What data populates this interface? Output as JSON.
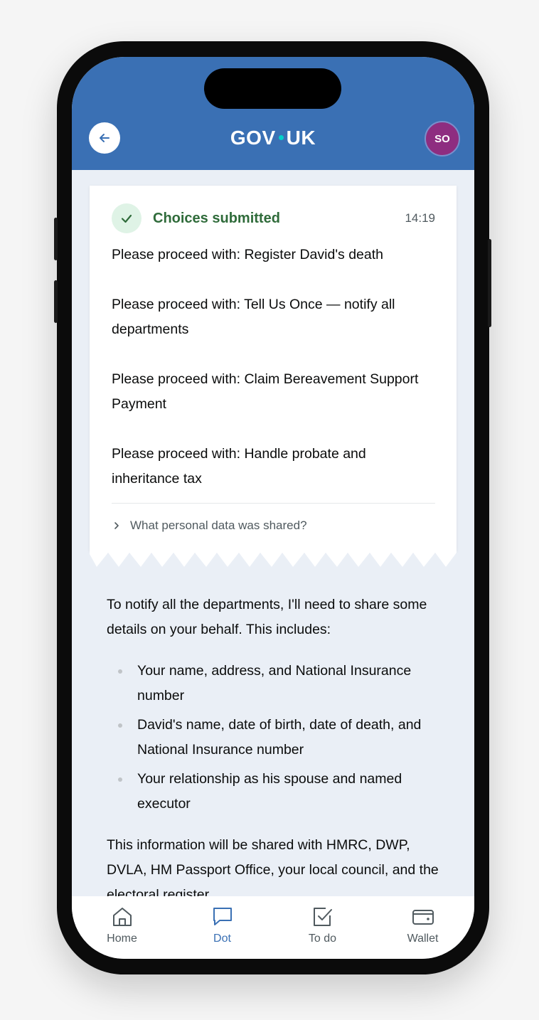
{
  "header": {
    "logo_left": "GOV",
    "logo_right": "UK",
    "avatar_initials": "SO",
    "brand_color": "#3a70b4"
  },
  "card": {
    "title": "Choices submitted",
    "time": "14:19",
    "items": [
      "Please proceed with: Register David's death",
      "Please proceed with: Tell Us Once — notify all departments",
      "Please proceed with: Claim Bereavement Support Payment",
      "Please proceed with: Handle probate and inheritance tax"
    ],
    "disclosure_label": "What personal data was shared?"
  },
  "message": {
    "intro": "To notify all the departments, I'll need to share some details on your behalf. This includes:",
    "bullets": [
      "Your name, address, and National Insurance number",
      "David's name, date of birth, date of death, and National Insurance number",
      "Your relationship as his spouse and named executor"
    ],
    "outro": "This information will be shared with HMRC, DWP, DVLA, HM Passport Office, your local council, and the electoral register."
  },
  "tabbar": {
    "tabs": [
      {
        "label": "Home",
        "icon": "home-icon"
      },
      {
        "label": "Dot",
        "icon": "chat-bubble-icon"
      },
      {
        "label": "To do",
        "icon": "checkbox-icon"
      },
      {
        "label": "Wallet",
        "icon": "wallet-icon"
      }
    ],
    "active_tab": "Dot"
  }
}
